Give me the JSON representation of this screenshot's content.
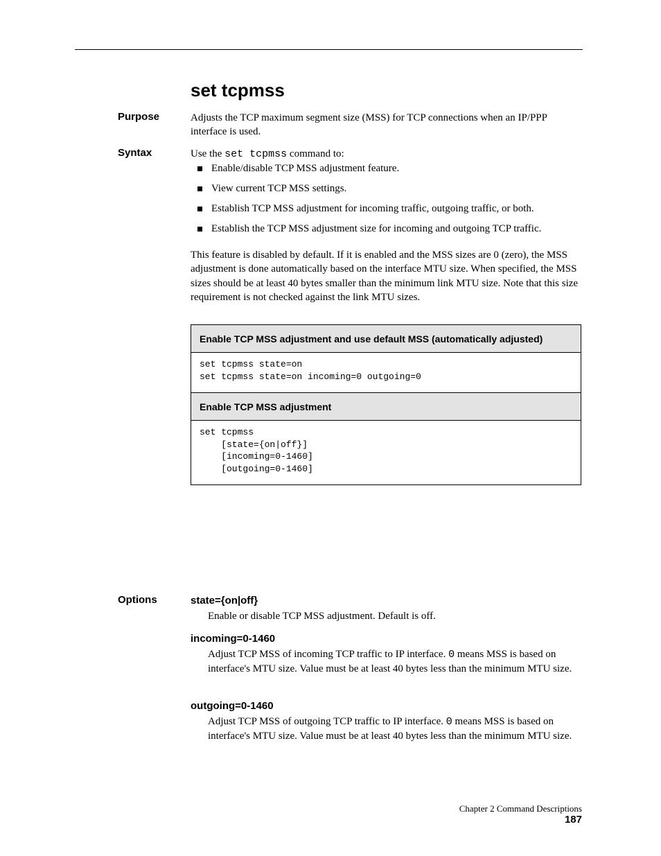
{
  "heading_main": "set tcpmss",
  "side_purpose": "Purpose",
  "purpose_text": "Adjusts the TCP maximum segment size (MSS) for TCP connections when an IP/PPP interface is used.",
  "side_syntax": "Syntax",
  "syntax_line1_pre": "Use the ",
  "syntax_line1_code": "set tcpmss",
  "syntax_line1_post": " command to:",
  "bullets": [
    "Enable/disable TCP MSS adjustment feature.",
    "View current TCP MSS settings.",
    "Establish TCP MSS adjustment for incoming traffic, outgoing traffic, or both.",
    "Establish the TCP MSS adjustment size for incoming and outgoing TCP traffic."
  ],
  "intro_para1": "This feature is disabled by default. If it is enabled and the MSS sizes are 0 (zero), the MSS adjustment is done automatically based on the interface MTU size. When specified, the MSS sizes should be at least 40 bytes smaller than the minimum link MTU size. Note that this size requirement is not checked against the link MTU sizes.",
  "table": {
    "header1": "Enable TCP MSS adjustment and use default MSS (automatically adjusted)",
    "code1": "set tcpmss state=on\nset tcpmss state=on incoming=0 outgoing=0",
    "header2": "Enable TCP MSS adjustment",
    "code2": "set tcpmss\n    [state={on|off}]\n    [incoming=0-1460]\n    [outgoing=0-1460]"
  },
  "side_options": "Options",
  "opt1_term": "state={on|off}",
  "opt1_desc": "Enable or disable TCP MSS adjustment. Default is off.",
  "opt2_term": "incoming=0-1460",
  "opt2_desc_a": "Adjust TCP MSS of incoming TCP traffic to IP interface. ",
  "opt2_desc_b": " means MSS is based on interface's MTU size. Value must be at least 40 bytes less than the minimum MTU size.",
  "opt2_zero": "0",
  "opt3_term": "outgoing=0-1460",
  "opt3_desc_a": "Adjust TCP MSS of outgoing TCP traffic to IP interface. ",
  "opt3_desc_b": " means MSS is based on interface's MTU size. Value must be at least 40 bytes less than the minimum MTU size.",
  "opt3_zero": "0",
  "footer_chapter": "Chapter 2 Command Descriptions",
  "footer_page": "187"
}
